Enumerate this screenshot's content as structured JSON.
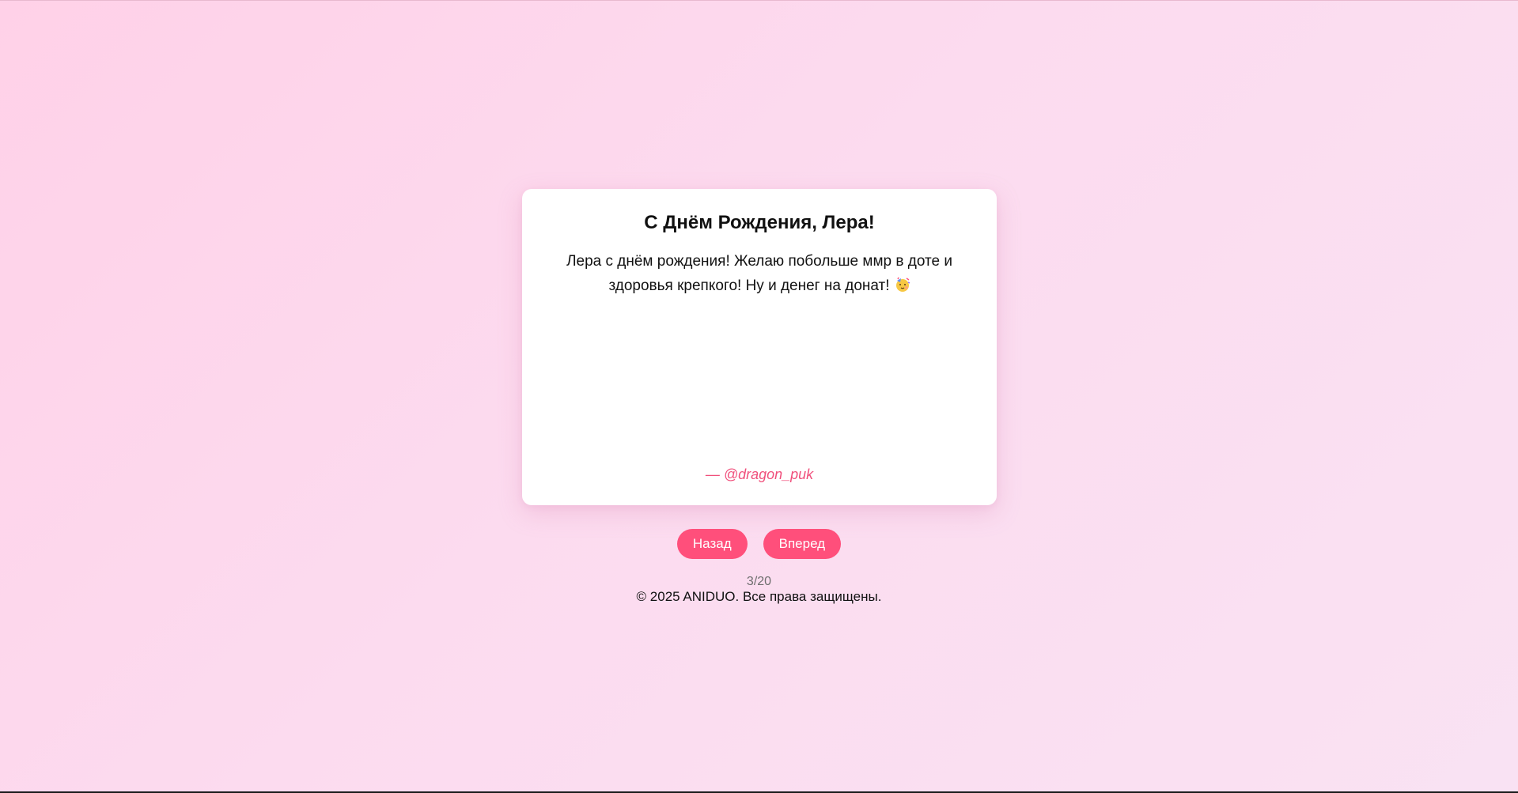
{
  "card": {
    "title": "С Днём Рождения, Лера!",
    "message": "Лера с днём рождения! Желаю побольше ммр в доте и здоровья крепкого! Ну и денег на донат!",
    "emoji_icon": "party-face-icon",
    "author": "— @dragon_puk"
  },
  "navigation": {
    "back_label": "Назад",
    "next_label": "Вперед"
  },
  "pagination": {
    "counter": "3/20"
  },
  "footer": {
    "copyright": "© 2025 ANIDUO. Все права защищены."
  },
  "colors": {
    "accent": "#ff4f7b",
    "author": "#f0507c",
    "background_start": "#ffd1e8",
    "background_end": "#f9e2f3"
  }
}
